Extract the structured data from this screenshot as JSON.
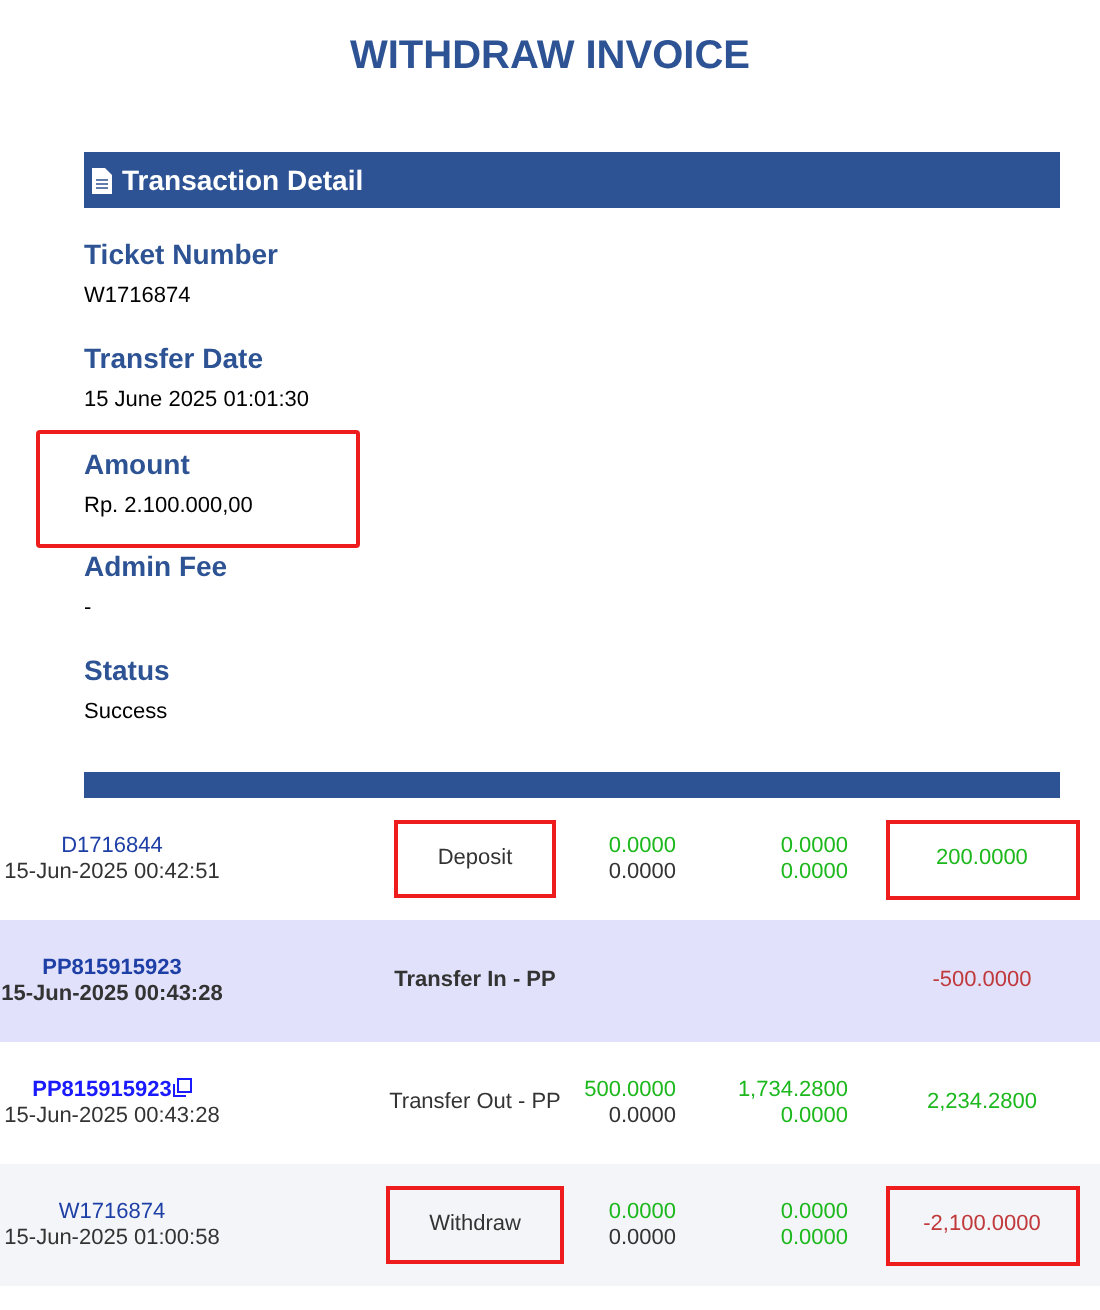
{
  "title": "WITHDRAW INVOICE",
  "transaction_detail": {
    "heading": "Transaction Detail",
    "fields": [
      {
        "label": "Ticket Number",
        "value": "W1716874",
        "highlighted": false
      },
      {
        "label": "Transfer Date",
        "value": "15 June 2025 01:01:30",
        "highlighted": false
      },
      {
        "label": "Amount",
        "value": "Rp. 2.100.000,00",
        "highlighted": true
      },
      {
        "label": "Admin Fee",
        "value": "-",
        "highlighted": false
      },
      {
        "label": "Status",
        "value": "Success",
        "highlighted": false
      }
    ]
  },
  "recipient_detail": {
    "kind": "covered"
  },
  "transactions": [
    {
      "id": "D1716844",
      "time": "15-Jun-2025 00:42:51",
      "selected": false,
      "copy": false,
      "type": "Deposit",
      "type_highlighted": true,
      "column_3": [
        "0.0000",
        "0.0000"
      ],
      "column_4": [
        "0.0000",
        "0.0000"
      ],
      "result": "200.0000",
      "color": "#1db81d",
      "result_highlighted": true
    },
    {
      "id": "PP815915923",
      "time": "15-Jun-2025 00:43:28",
      "selected": true,
      "copy": false,
      "type": "Transfer In - PP",
      "type_highlighted": false,
      "result": "-500.0000",
      "color": "#c0393b",
      "result_highlighted": false
    },
    {
      "id": "PP815915923",
      "time": "15-Jun-2025 00:43:28",
      "selected": false,
      "copy": true,
      "type": "Transfer Out - PP",
      "type_highlighted": false,
      "column_3": [
        "500.0000",
        "0.0000"
      ],
      "column_4": [
        "1,734.2800",
        "0.0000"
      ],
      "result": "2,234.2800",
      "color": "#1db81d",
      "result_highlighted": false
    },
    {
      "id": "W1716874",
      "time": "15-Jun-2025 01:00:58",
      "selected": false,
      "copy": false,
      "type": "Withdraw",
      "type_highlighted": true,
      "column_3": [
        "0.0000",
        "0.0000"
      ],
      "column_4": [
        "0.0000",
        "0.0000"
      ],
      "result": "-2,100.0000",
      "color": "#c0393b",
      "result_highlighted": true
    }
  ]
}
